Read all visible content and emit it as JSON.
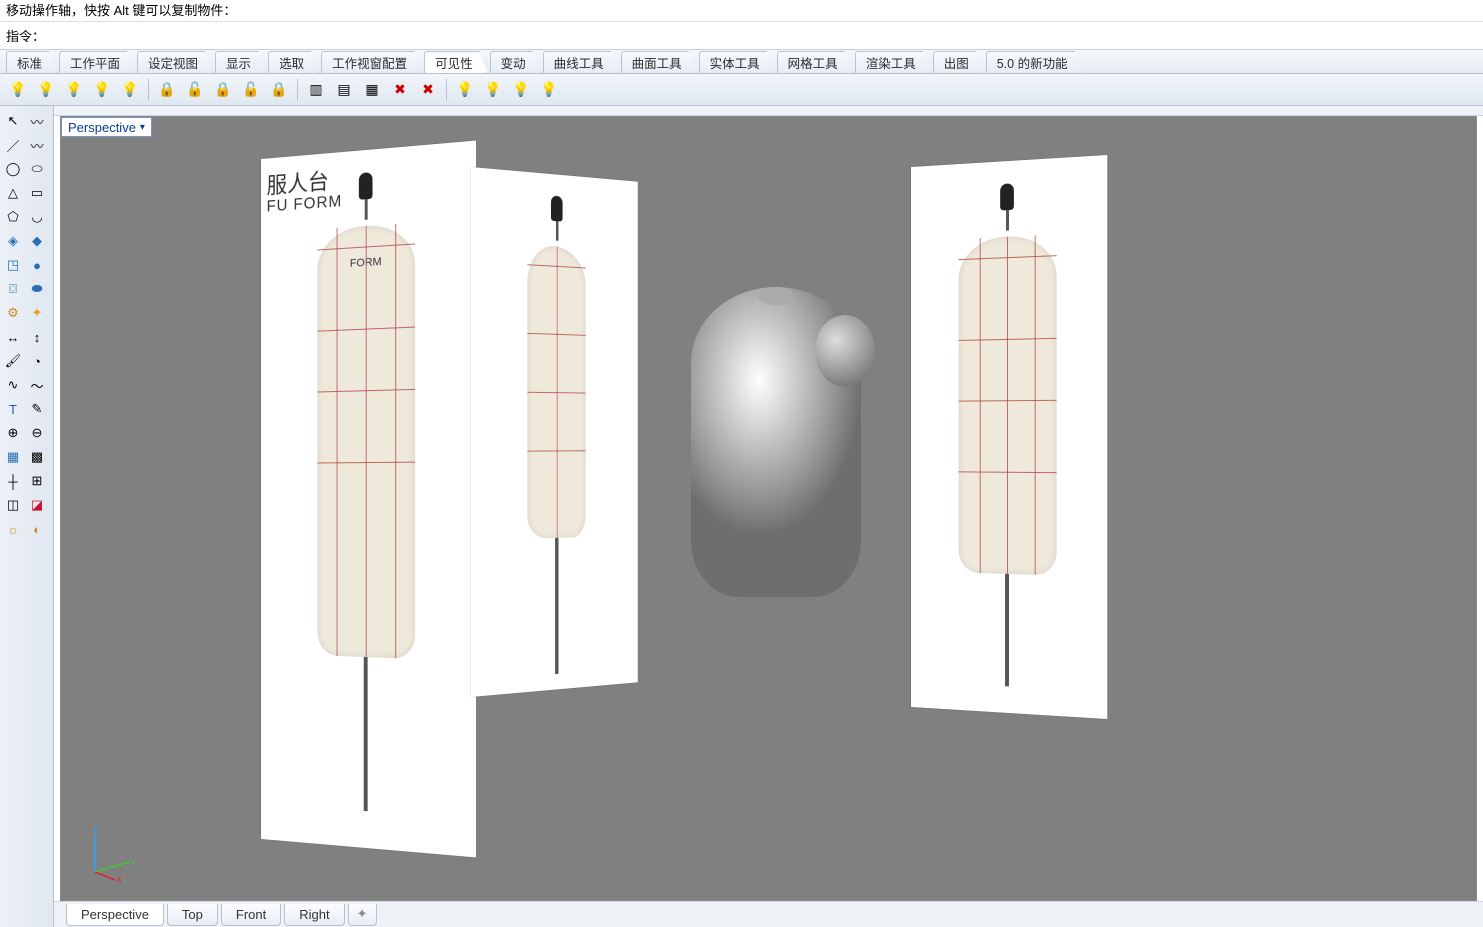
{
  "status_text": "移动操作轴，快按 Alt 键可以复制物件：",
  "command_label": "指令：",
  "command_value": "",
  "tabs": [
    {
      "label": "标准"
    },
    {
      "label": "工作平面"
    },
    {
      "label": "设定视图"
    },
    {
      "label": "显示"
    },
    {
      "label": "选取"
    },
    {
      "label": "工作视窗配置"
    },
    {
      "label": "可见性"
    },
    {
      "label": "变动"
    },
    {
      "label": "曲线工具"
    },
    {
      "label": "曲面工具"
    },
    {
      "label": "实体工具"
    },
    {
      "label": "网格工具"
    },
    {
      "label": "渲染工具"
    },
    {
      "label": "出图"
    },
    {
      "label": "5.0 的新功能"
    }
  ],
  "active_tab_index": 6,
  "viewport_label": "Perspective",
  "bottom_tabs": [
    {
      "label": "Perspective"
    },
    {
      "label": "Top"
    },
    {
      "label": "Front"
    },
    {
      "label": "Right"
    }
  ],
  "active_bottom_tab": 0,
  "reference": {
    "brand_cn_partial": "服人台",
    "brand_en_partial": "FU FORM",
    "front_label": "FORM"
  },
  "axis": {
    "x": "x",
    "y": "y",
    "z": "z"
  },
  "icons": {
    "bulb": "💡",
    "bulb_dim": "💡",
    "lock": "🔒",
    "unlock": "🔓",
    "panel": "▥",
    "layers": "▤",
    "redx": "✖",
    "help": "?",
    "sel": "▦",
    "pointer": "↖",
    "line": "／",
    "curve": "〰",
    "circle": "◯",
    "ellipse": "⬭",
    "poly": "△",
    "rect": "▭",
    "polygon": "⬠",
    "arc": "◡",
    "srf1": "◈",
    "srf2": "◆",
    "box": "◳",
    "sphere": "●",
    "cyl": "⌼",
    "pipe": "⬬",
    "gear1": "⚙",
    "gear2": "✦",
    "dim": "↔",
    "dim2": "↕",
    "paint": "🖌",
    "clr": "◔",
    "crv1": "∿",
    "crv2": "〜",
    "text": "T",
    "annot": "✎",
    "bool1": "⊕",
    "bool2": "⊖",
    "mesh": "▦",
    "mesh2": "▩",
    "grid": "┼",
    "grid2": "⊞",
    "util1": "◫",
    "util2": "◪",
    "rend": "☼",
    "rend2": "◐"
  }
}
